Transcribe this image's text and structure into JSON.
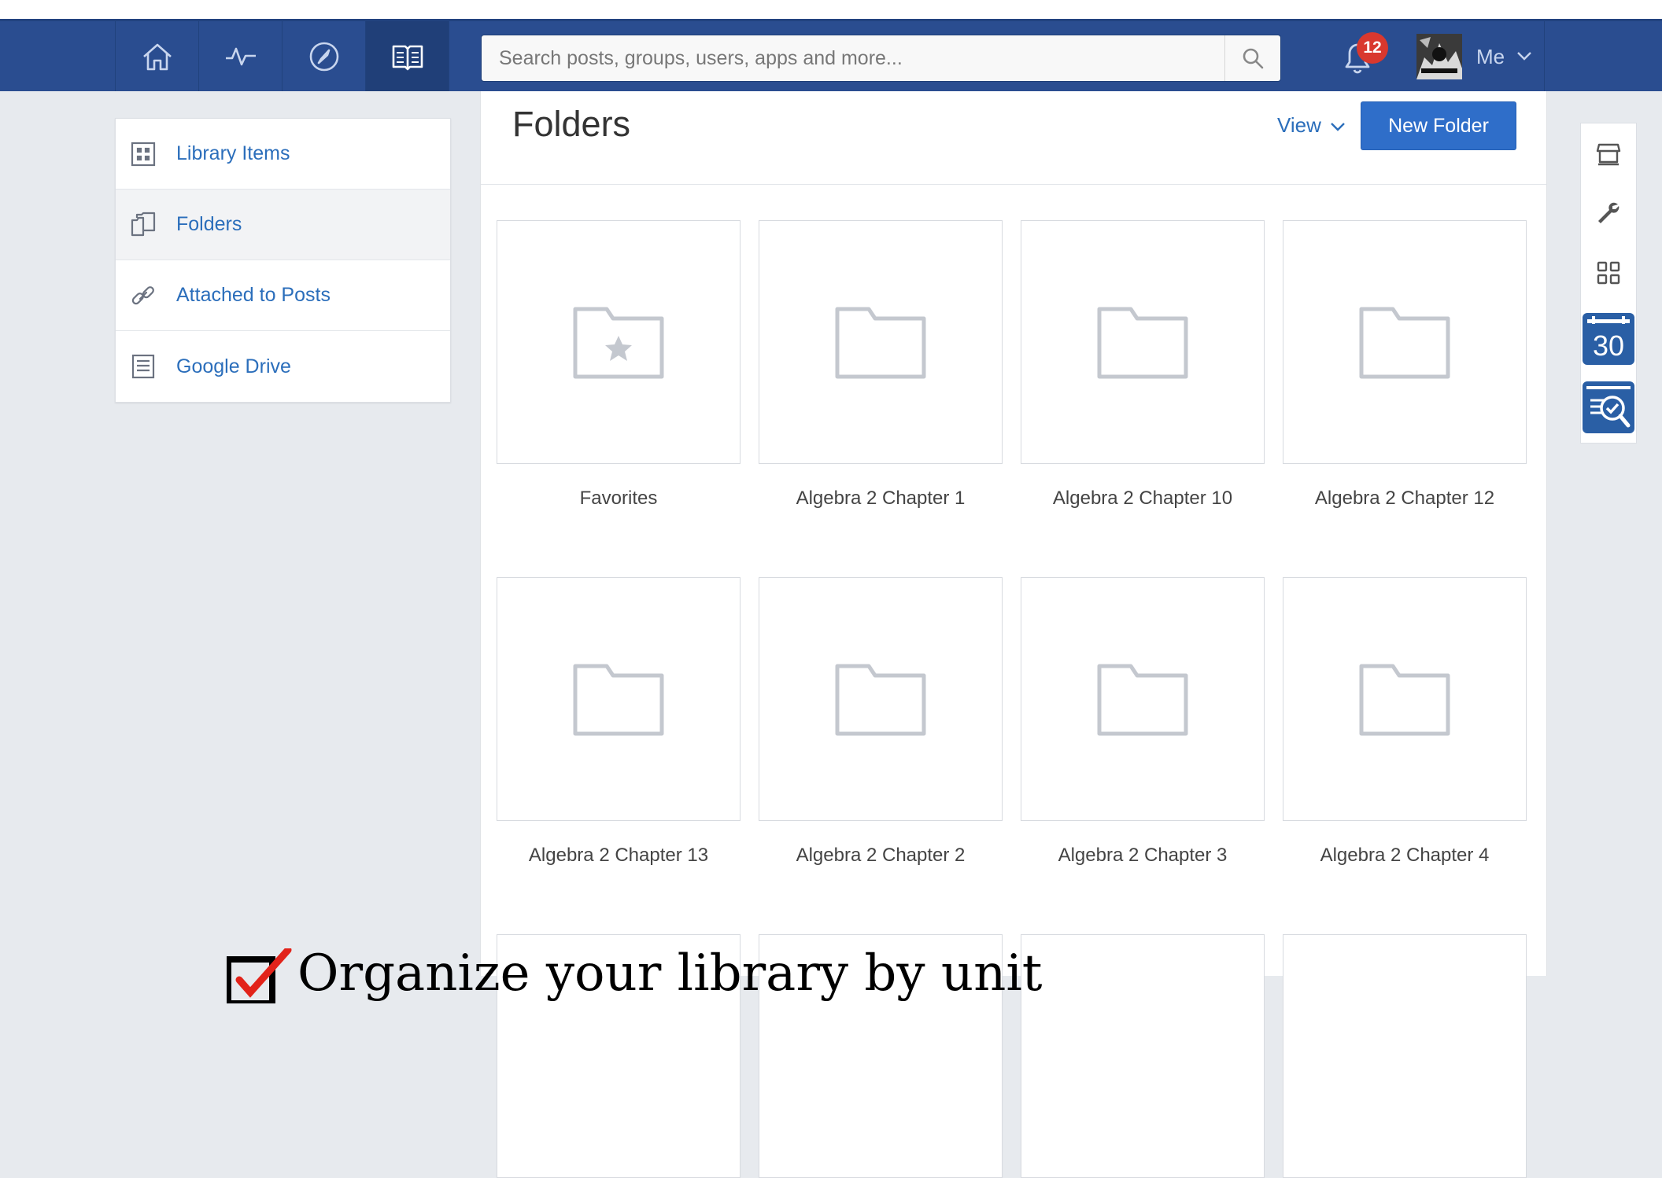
{
  "nav": {
    "icons": [
      "home-icon",
      "activity-icon",
      "compass-icon",
      "book-icon"
    ],
    "search_placeholder": "Search posts, groups, users, apps and more...",
    "notification_count": "12",
    "user_label": "Me"
  },
  "sidebar": {
    "items": [
      {
        "label": "Library Items",
        "icon": "grid-icon"
      },
      {
        "label": "Folders",
        "icon": "folders-icon"
      },
      {
        "label": "Attached to Posts",
        "icon": "link-icon"
      },
      {
        "label": "Google Drive",
        "icon": "document-icon"
      }
    ],
    "active": "Folders"
  },
  "main": {
    "title": "Folders",
    "view_label": "View",
    "new_folder_label": "New Folder",
    "folders": [
      "Favorites",
      "Algebra 2 Chapter 1",
      "Algebra 2 Chapter 10",
      "Algebra 2 Chapter 12",
      "Algebra 2 Chapter 13",
      "Algebra 2 Chapter 2",
      "Algebra 2 Chapter 3",
      "Algebra 2 Chapter 4"
    ]
  },
  "rail": {
    "icons": [
      "store-icon",
      "wrench-icon",
      "apps-grid-icon",
      "calendar-icon",
      "review-icon"
    ],
    "calendar_day": "30"
  },
  "overlay": {
    "text": "Organize your library by unit"
  },
  "colors": {
    "navbar": "#2a4d90",
    "accent": "#2f6ec9",
    "link": "#2b6ebb",
    "badge": "#d9382e"
  }
}
